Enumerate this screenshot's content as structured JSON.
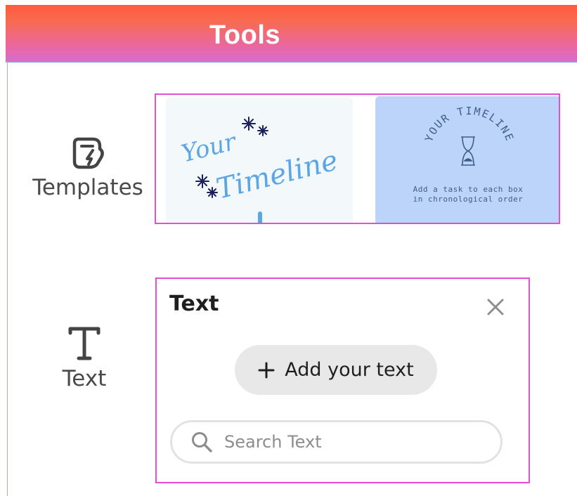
{
  "header": {
    "title": "Tools"
  },
  "tools": {
    "templates_label": "Templates",
    "text_label": "Text"
  },
  "templates_panel": {
    "cards": [
      {
        "text_line1": "Your",
        "text_line2": "Timeline"
      },
      {
        "arc_title": "YOUR TIMELINE",
        "subtitle_line1": "Add a task to each box",
        "subtitle_line2": "in chronological order"
      }
    ]
  },
  "text_panel": {
    "title": "Text",
    "add_button_label": "Add your text",
    "search_placeholder": "Search Text"
  },
  "colors": {
    "accent_border": "#e34fd0",
    "header_gradient_start": "#ff5a3c",
    "header_gradient_end": "#d96ccb",
    "card2_bg": "#bcd3fa",
    "script_blue": "#5aa6e6",
    "star_navy": "#1c1f5e"
  }
}
